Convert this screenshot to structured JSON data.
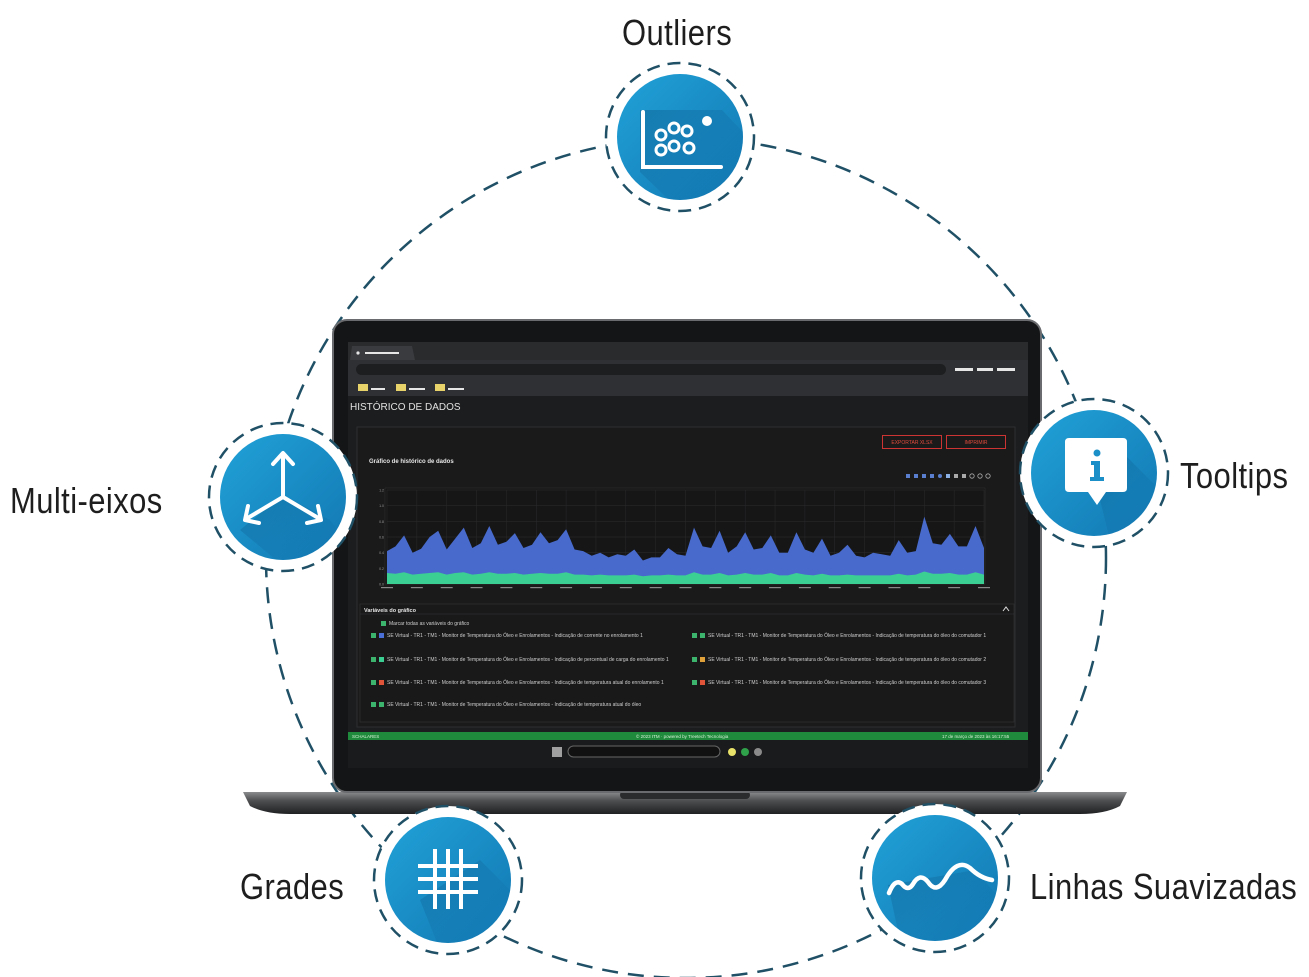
{
  "features": {
    "outliers": "Outliers",
    "multi_axes": "Multi-eixos",
    "tooltips": "Tooltips",
    "grids": "Grades",
    "smooth_lines": "Linhas Suavizadas"
  },
  "icons": {
    "outliers": "scatter-outliers-icon",
    "multi_axes": "three-axes-icon",
    "tooltips": "info-tooltip-icon",
    "grids": "grid-icon",
    "smooth_lines": "smooth-wave-icon"
  },
  "colors": {
    "accent_blue": "#1b8fc7",
    "dash_ring": "#1f5066",
    "label_text": "#1e1e1e",
    "series_blue": "#4a6fd6",
    "series_green": "#3ccf94",
    "status_green": "#1f8a3b",
    "button_red": "#e04a3a"
  },
  "screen": {
    "page_title": "HISTÓRICO DE DADOS",
    "chart_title": "Gráfico de histórico de dados",
    "export_button": "EXPORTAR XLSX",
    "print_button": "IMPRIMIR",
    "variables_header": "Variáveis do gráfico",
    "select_all": "Marcar todas as variáveis do gráfico",
    "variables": [
      {
        "text": "SE Virtual - TR1 - TM1 - Monitor de Temperatura do Óleo e Enrolamentos - Indicação de corrente no enrolamento 1",
        "color": "#3cb46e"
      },
      {
        "text": "SE Virtual - TR1 - TM1 - Monitor de Temperatura do Óleo e Enrolamentos - Indicação de percentual de carga do enrolamento 1",
        "color": "#3cb46e"
      },
      {
        "text": "SE Virtual - TR1 - TM1 - Monitor de Temperatura do Óleo e Enrolamentos - Indicação de temperatura atual do enrolamento 1",
        "color": "#e0543a"
      },
      {
        "text": "SE Virtual - TR1 - TM1 - Monitor de Temperatura do Óleo e Enrolamentos - Indicação de temperatura atual do óleo",
        "color": "#3cb46e"
      },
      {
        "text": "SE Virtual - TR1 - TM1 - Monitor de Temperatura do Óleo e Enrolamentos - Indicação de temperatura do óleo do comutador 1",
        "color": "#3cb46e"
      },
      {
        "text": "SE Virtual - TR1 - TM1 - Monitor de Temperatura do Óleo e Enrolamentos - Indicação de temperatura do óleo do comutador 2",
        "color": "#e0a03a"
      },
      {
        "text": "SE Virtual - TR1 - TM1 - Monitor de Temperatura do Óleo e Enrolamentos - Indicação de temperatura do óleo do comutador 3",
        "color": "#e0543a"
      }
    ],
    "status_left": "SCHALARES",
    "status_mid": "© 2023 ITM · powered by Treetech Tecnologia",
    "status_right": "17 de março de 2023 às 16:17:55"
  },
  "chart_data": {
    "type": "area",
    "title": "Gráfico de histórico de dados",
    "ylim": [
      0,
      1.2
    ],
    "y_ticks": [
      "0.0",
      "0.2",
      "0.4",
      "0.6",
      "0.8",
      "1.0",
      "1.2"
    ],
    "series": [
      {
        "values": [
          0.42,
          0.48,
          0.62,
          0.4,
          0.45,
          0.6,
          0.68,
          0.44,
          0.58,
          0.72,
          0.46,
          0.52,
          0.74,
          0.5,
          0.54,
          0.65,
          0.46,
          0.5,
          0.66,
          0.52,
          0.56,
          0.7,
          0.44,
          0.42,
          0.36,
          0.4,
          0.34,
          0.38,
          0.36,
          0.44,
          0.3,
          0.34,
          0.34,
          0.46,
          0.38,
          0.36,
          0.72,
          0.48,
          0.46,
          0.68,
          0.4,
          0.48,
          0.66,
          0.44,
          0.46,
          0.62,
          0.4,
          0.4,
          0.66,
          0.44,
          0.4,
          0.58,
          0.36,
          0.4,
          0.5,
          0.36,
          0.34,
          0.4,
          0.38,
          0.36,
          0.56,
          0.4,
          0.42,
          0.86,
          0.52,
          0.5,
          0.64,
          0.48,
          0.48,
          0.74,
          0.46
        ]
      },
      {
        "values": [
          0.14,
          0.13,
          0.15,
          0.12,
          0.13,
          0.14,
          0.15,
          0.12,
          0.14,
          0.15,
          0.12,
          0.13,
          0.15,
          0.13,
          0.13,
          0.14,
          0.12,
          0.13,
          0.14,
          0.13,
          0.13,
          0.15,
          0.12,
          0.12,
          0.11,
          0.12,
          0.11,
          0.11,
          0.11,
          0.12,
          0.1,
          0.11,
          0.11,
          0.12,
          0.11,
          0.11,
          0.15,
          0.12,
          0.12,
          0.14,
          0.11,
          0.12,
          0.14,
          0.12,
          0.12,
          0.14,
          0.11,
          0.11,
          0.14,
          0.12,
          0.11,
          0.13,
          0.11,
          0.11,
          0.12,
          0.11,
          0.11,
          0.11,
          0.11,
          0.11,
          0.13,
          0.11,
          0.12,
          0.16,
          0.13,
          0.13,
          0.14,
          0.12,
          0.12,
          0.15,
          0.12
        ]
      }
    ],
    "x_tick_count": 21,
    "grid": true
  }
}
